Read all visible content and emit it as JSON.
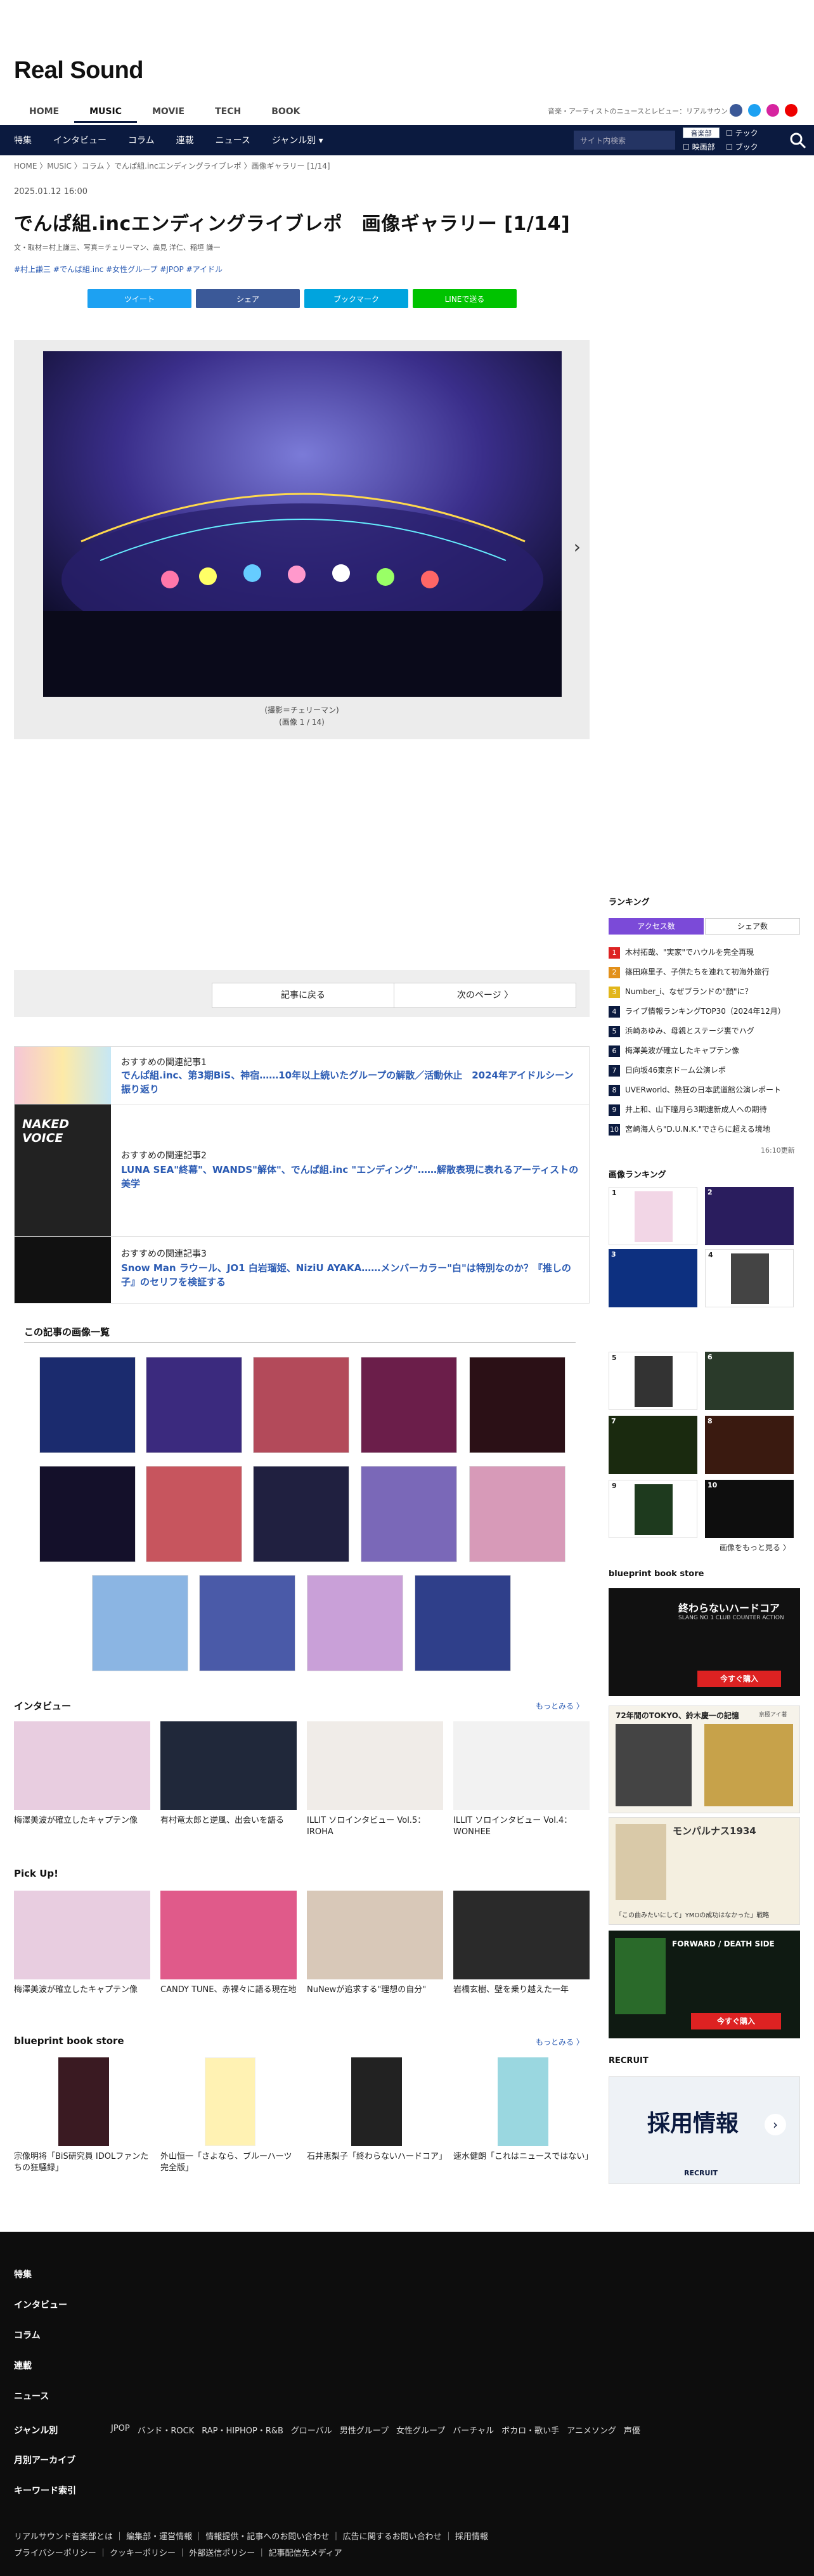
{
  "site": {
    "logo": "Real Sound",
    "tagline": "音楽・アーティストのニュースとレビュー：リアルサウンド"
  },
  "tabs": [
    "HOME",
    "MUSIC",
    "MOVIE",
    "TECH",
    "BOOK"
  ],
  "active_tab": "MUSIC",
  "nav": {
    "items": [
      "特集",
      "インタビュー",
      "コラム",
      "連載",
      "ニュース",
      "ジャンル別 ▾"
    ],
    "search_placeholder": "サイト内検索",
    "toggle": "音楽部",
    "toggle2": "映画部",
    "chk1": "テック",
    "chk2": "ブック"
  },
  "breadcrumb": "HOME  〉MUSIC  〉コラム  〉でんぱ組.incエンディングライブレポ  〉画像ギャラリー [1/14]",
  "article": {
    "date": "2025.01.12 16:00",
    "title": "でんぱ組.incエンディングライブレポ　画像ギャラリー [1/14]",
    "credit": "文・取材＝村上謙三、写真＝チェリーマン、高見 洋仁、稲垣 謙一",
    "tags": "#村上謙三 #でんぱ組.inc #女性グループ #JPOP #アイドル"
  },
  "share": {
    "tweet": "ツイート",
    "facebook": "シェア",
    "hatena": "ブックマーク",
    "line": "LINEで送る"
  },
  "gallery": {
    "caption": "(撮影＝チェリーマン)",
    "counter": "(画像 1 / 14)"
  },
  "pager": {
    "back": "記事に戻る",
    "next": "次のページ 〉"
  },
  "recommended": [
    {
      "label": "おすすめの関連記事1",
      "headline": "でんぱ組.inc、第3期BiS、神宿……10年以上続いたグループの解散／活動休止　2024年アイドルシーン振り返り"
    },
    {
      "label": "おすすめの関連記事2",
      "headline": "LUNA SEA\"終幕\"、WANDS\"解体\"、でんぱ組.inc \"エンディング\"……解散表現に表れるアーティストの美学"
    },
    {
      "label": "おすすめの関連記事3",
      "headline": "Snow Man ラウール、JO1 白岩瑠姫、NiziU AYAKA……メンバーカラー\"白\"は特別なのか？『推しの子』のセリフを検証する"
    }
  ],
  "recommended_badge": "NAKED VOICE",
  "images_title": "この記事の画像一覧",
  "interview": {
    "title": "インタビュー",
    "more": "もっとみる 〉",
    "items": [
      "梅澤美波が確立したキャプテン像",
      "有村竜太郎と逆風、出会いを語る",
      "ILLIT ソロインタビュー Vol.5：IROHA",
      "ILLIT ソロインタビュー Vol.4：WONHEE"
    ]
  },
  "pickup": {
    "title": "Pick Up!",
    "items": [
      "梅澤美波が確立したキャプテン像",
      "CANDY TUNE、赤裸々に語る現在地",
      "NuNewが追求する\"理想の自分\"",
      "岩橋玄樹、壁を乗り越えた一年"
    ]
  },
  "bookstore": {
    "title": "blueprint book store",
    "more": "もっとみる 〉",
    "items": [
      "宗像明将「BiS研究員 IDOLファンたちの狂騒録」",
      "外山恒一「さよなら、ブルーハーツ完全版」",
      "石井恵梨子「終わらないハードコア」",
      "速水健朗「これはニュースではない」"
    ]
  },
  "sidebar": {
    "ranking_title": "ランキング",
    "tab_access": "アクセス数",
    "tab_share": "シェア数",
    "ranking": [
      "木村拓哉、\"実家\"でハウルを完全再現",
      "篠田麻里子、子供たちを連れて初海外旅行",
      "Number_i、なぜブランドの\"顔\"に？",
      "ライブ情報ランキングTOP30（2024年12月）",
      "浜崎あゆみ、母親とステージ裏でハグ",
      "梅澤美波が確立したキャプテン像",
      "日向坂46東京ドーム公演レポ",
      "UVERworld、熱狂の日本武道館公演レポート",
      "井上和、山下瞳月ら3期逮新成人への期待",
      "宮崎海人ら\"D.U.N.K.\"でさらに超える境地"
    ],
    "updated": "16:10更新",
    "image_ranking_title": "画像ランキング",
    "image_more": "画像をもっと見る 〉",
    "bookstore_title": "blueprint book store",
    "book1": {
      "title": "終わらないハードコア",
      "sub": "SLANG NO 1 CLUB COUNTER ACTION",
      "btn": "今すぐ購入"
    },
    "book2": {
      "title": "72年間のTOKYO、鈴木慶一の記憶",
      "author": "京極アイ著"
    },
    "book3": {
      "title": "モンパルナス1934",
      "author": "「この曲みたいにして」YMOの成功はなかった」戦略"
    },
    "book4": {
      "title": "FORWARD / DEATH SIDE",
      "btn": "今すぐ購入"
    },
    "recruit_title": "RECRUIT",
    "recruit_text": "採用情報",
    "recruit_logo": "RECRUIT"
  },
  "footer": {
    "items": [
      "特集",
      "インタビュー",
      "コラム",
      "連載",
      "ニュース",
      "ジャンル別",
      "月別アーカイブ",
      "キーワード索引"
    ],
    "genres": [
      "JPOP",
      "バンド・ROCK",
      "RAP・HIPHOP・R&B",
      "グローバル",
      "男性グループ",
      "女性グループ",
      "バーチャル",
      "ボカロ・歌い手",
      "アニメソング",
      "声優"
    ],
    "links1": "リアルサウンド音楽部とは ｜ 編集部・運営情報 ｜ 情報提供・記事へのお問い合わせ ｜ 広告に関するお問い合わせ ｜ 採用情報",
    "links2": "プライバシーポリシー ｜ クッキーポリシー ｜ 外部送信ポリシー ｜ 記事配信先メディア"
  },
  "colors": {
    "navy": "#0b1a3f",
    "twitter": "#1da1f2",
    "facebook": "#3b5998",
    "hatena": "#00a4de",
    "line": "#00c300",
    "link": "#2b5bb3",
    "ranking_tab": "#7b4ad8"
  }
}
